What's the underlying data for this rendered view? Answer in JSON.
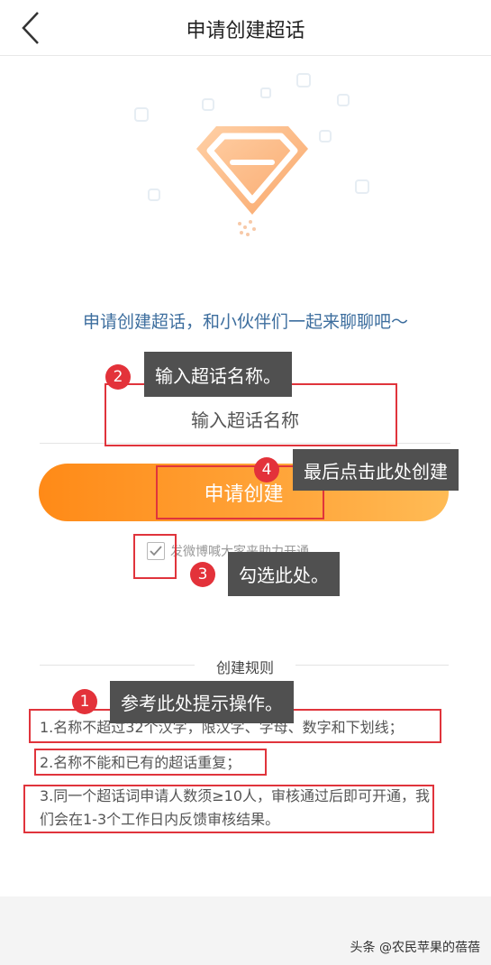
{
  "header": {
    "title": "申请创建超话"
  },
  "main": {
    "tagline": "申请创建超话，和小伙伴们一起来聊聊吧～",
    "name_input": {
      "value": "",
      "placeholder": "输入超话名称"
    },
    "create_button": "申请创建",
    "share_checkbox": {
      "checked": true,
      "label": "发微博喊大家来助力开通"
    }
  },
  "rules": {
    "title": "创建规则",
    "items": [
      "1.名称不超过32个汉字，限汉字、字母、数字和下划线；",
      "2.名称不能和已有的超话重复；",
      "3.同一个超话词申请人数须≥10人，审核通过后即可开通，我们会在1-3个工作日内反馈审核结果。"
    ]
  },
  "annotations": [
    {
      "number": "1",
      "text": "参考此处提示操作。"
    },
    {
      "number": "2",
      "text": "输入超话名称。"
    },
    {
      "number": "3",
      "text": "勾选此处。"
    },
    {
      "number": "4",
      "text": "最后点击此处创建"
    }
  ],
  "watermark": "头条 @农民苹果的蓓蓓",
  "colors": {
    "accent_orange": "#ff8a17",
    "annotation_red": "#e0343c",
    "tagline_blue": "#3d6e9e"
  },
  "icons": [
    "back-chevron-icon",
    "super-topic-diamond-icon",
    "checkmark-icon"
  ]
}
